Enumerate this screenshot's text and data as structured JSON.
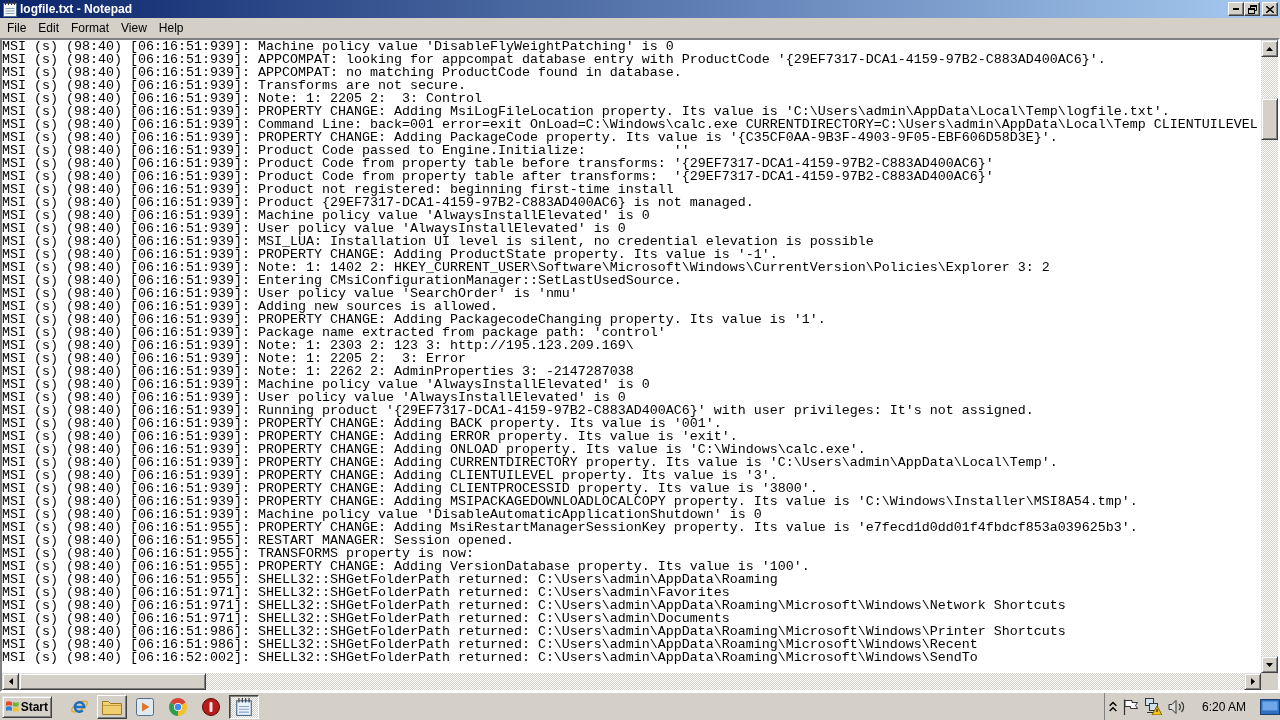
{
  "window": {
    "title": "logfile.txt - Notepad"
  },
  "menu": [
    "File",
    "Edit",
    "Format",
    "View",
    "Help"
  ],
  "editor": {
    "lines": [
      "MSI (s) (98:40) [06:16:51:939]: Machine policy value 'DisableFlyWeightPatching' is 0",
      "MSI (s) (98:40) [06:16:51:939]: APPCOMPAT: looking for appcompat database entry with ProductCode '{29EF7317-DCA1-4159-97B2-C883AD400AC6}'.",
      "MSI (s) (98:40) [06:16:51:939]: APPCOMPAT: no matching ProductCode found in database.",
      "MSI (s) (98:40) [06:16:51:939]: Transforms are not secure.",
      "MSI (s) (98:40) [06:16:51:939]: Note: 1: 2205 2:  3: Control",
      "MSI (s) (98:40) [06:16:51:939]: PROPERTY CHANGE: Adding MsiLogFileLocation property. Its value is 'C:\\Users\\admin\\AppData\\Local\\Temp\\logfile.txt'.",
      "MSI (s) (98:40) [06:16:51:939]: Command Line: back=001 error=exit OnLoad=C:\\Windows\\calc.exe CURRENTDIRECTORY=C:\\Users\\admin\\AppData\\Local\\Temp CLIENTUILEVEL",
      "MSI (s) (98:40) [06:16:51:939]: PROPERTY CHANGE: Adding PackageCode property. Its value is '{C35CF0AA-9B3F-4903-9F05-EBF606D58D3E}'.",
      "MSI (s) (98:40) [06:16:51:939]: Product Code passed to Engine.Initialize:           ''",
      "MSI (s) (98:40) [06:16:51:939]: Product Code from property table before transforms: '{29EF7317-DCA1-4159-97B2-C883AD400AC6}'",
      "MSI (s) (98:40) [06:16:51:939]: Product Code from property table after transforms:  '{29EF7317-DCA1-4159-97B2-C883AD400AC6}'",
      "MSI (s) (98:40) [06:16:51:939]: Product not registered: beginning first-time install",
      "MSI (s) (98:40) [06:16:51:939]: Product {29EF7317-DCA1-4159-97B2-C883AD400AC6} is not managed.",
      "MSI (s) (98:40) [06:16:51:939]: Machine policy value 'AlwaysInstallElevated' is 0",
      "MSI (s) (98:40) [06:16:51:939]: User policy value 'AlwaysInstallElevated' is 0",
      "MSI (s) (98:40) [06:16:51:939]: MSI_LUA: Installation UI level is silent, no credential elevation is possible",
      "MSI (s) (98:40) [06:16:51:939]: PROPERTY CHANGE: Adding ProductState property. Its value is '-1'.",
      "MSI (s) (98:40) [06:16:51:939]: Note: 1: 1402 2: HKEY_CURRENT_USER\\Software\\Microsoft\\Windows\\CurrentVersion\\Policies\\Explorer 3: 2",
      "MSI (s) (98:40) [06:16:51:939]: Entering CMsiConfigurationManager::SetLastUsedSource.",
      "MSI (s) (98:40) [06:16:51:939]: User policy value 'SearchOrder' is 'nmu'",
      "MSI (s) (98:40) [06:16:51:939]: Adding new sources is allowed.",
      "MSI (s) (98:40) [06:16:51:939]: PROPERTY CHANGE: Adding PackagecodeChanging property. Its value is '1'.",
      "MSI (s) (98:40) [06:16:51:939]: Package name extracted from package path: 'control'",
      "MSI (s) (98:40) [06:16:51:939]: Note: 1: 2303 2: 123 3: http://195.123.209.169\\",
      "MSI (s) (98:40) [06:16:51:939]: Note: 1: 2205 2:  3: Error",
      "MSI (s) (98:40) [06:16:51:939]: Note: 1: 2262 2: AdminProperties 3: -2147287038",
      "MSI (s) (98:40) [06:16:51:939]: Machine policy value 'AlwaysInstallElevated' is 0",
      "MSI (s) (98:40) [06:16:51:939]: User policy value 'AlwaysInstallElevated' is 0",
      "MSI (s) (98:40) [06:16:51:939]: Running product '{29EF7317-DCA1-4159-97B2-C883AD400AC6}' with user privileges: It's not assigned.",
      "MSI (s) (98:40) [06:16:51:939]: PROPERTY CHANGE: Adding BACK property. Its value is '001'.",
      "MSI (s) (98:40) [06:16:51:939]: PROPERTY CHANGE: Adding ERROR property. Its value is 'exit'.",
      "MSI (s) (98:40) [06:16:51:939]: PROPERTY CHANGE: Adding ONLOAD property. Its value is 'C:\\Windows\\calc.exe'.",
      "MSI (s) (98:40) [06:16:51:939]: PROPERTY CHANGE: Adding CURRENTDIRECTORY property. Its value is 'C:\\Users\\admin\\AppData\\Local\\Temp'.",
      "MSI (s) (98:40) [06:16:51:939]: PROPERTY CHANGE: Adding CLIENTUILEVEL property. Its value is '3'.",
      "MSI (s) (98:40) [06:16:51:939]: PROPERTY CHANGE: Adding CLIENTPROCESSID property. Its value is '3800'.",
      "MSI (s) (98:40) [06:16:51:939]: PROPERTY CHANGE: Adding MSIPACKAGEDOWNLOADLOCALCOPY property. Its value is 'C:\\Windows\\Installer\\MSI8A54.tmp'.",
      "MSI (s) (98:40) [06:16:51:939]: Machine policy value 'DisableAutomaticApplicationShutdown' is 0",
      "MSI (s) (98:40) [06:16:51:955]: PROPERTY CHANGE: Adding MsiRestartManagerSessionKey property. Its value is 'e7fecd1d0dd01f4fbdcf853a039625b3'.",
      "MSI (s) (98:40) [06:16:51:955]: RESTART MANAGER: Session opened.",
      "MSI (s) (98:40) [06:16:51:955]: TRANSFORMS property is now:",
      "MSI (s) (98:40) [06:16:51:955]: PROPERTY CHANGE: Adding VersionDatabase property. Its value is '100'.",
      "MSI (s) (98:40) [06:16:51:955]: SHELL32::SHGetFolderPath returned: C:\\Users\\admin\\AppData\\Roaming",
      "MSI (s) (98:40) [06:16:51:971]: SHELL32::SHGetFolderPath returned: C:\\Users\\admin\\Favorites",
      "MSI (s) (98:40) [06:16:51:971]: SHELL32::SHGetFolderPath returned: C:\\Users\\admin\\AppData\\Roaming\\Microsoft\\Windows\\Network Shortcuts",
      "MSI (s) (98:40) [06:16:51:971]: SHELL32::SHGetFolderPath returned: C:\\Users\\admin\\Documents",
      "MSI (s) (98:40) [06:16:51:986]: SHELL32::SHGetFolderPath returned: C:\\Users\\admin\\AppData\\Roaming\\Microsoft\\Windows\\Printer Shortcuts",
      "MSI (s) (98:40) [06:16:51:986]: SHELL32::SHGetFolderPath returned: C:\\Users\\admin\\AppData\\Roaming\\Microsoft\\Windows\\Recent",
      "MSI (s) (98:40) [06:16:52:002]: SHELL32::SHGetFolderPath returned: C:\\Users\\admin\\AppData\\Roaming\\Microsoft\\Windows\\SendTo"
    ]
  },
  "taskbar": {
    "start": "Start",
    "apps": [
      {
        "kind": "browser",
        "open": false,
        "selected": false
      },
      {
        "kind": "folder",
        "open": true,
        "selected": false
      },
      {
        "kind": "player",
        "open": false,
        "selected": false
      },
      {
        "kind": "wheel",
        "open": false,
        "selected": false
      },
      {
        "kind": "alert",
        "open": false,
        "selected": false
      },
      {
        "kind": "notepad",
        "open": true,
        "selected": true
      }
    ],
    "clock": "6:20 AM"
  }
}
